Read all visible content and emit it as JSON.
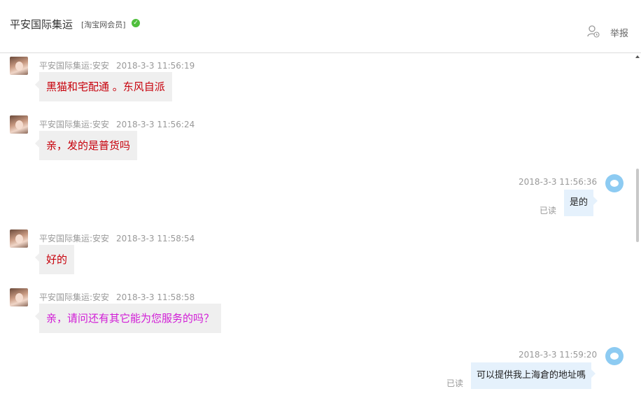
{
  "header": {
    "shop_name": "平安国际集运",
    "shop_tag": "[淘宝网会员]",
    "report_label": "举报"
  },
  "messages": [
    {
      "sender": "平安国际集运:安安",
      "time": "2018-3-3 11:56:19",
      "text": "黑猫和宅配通 。东风自派",
      "side": "left"
    },
    {
      "sender": "平安国际集运:安安",
      "time": "2018-3-3 11:56:24",
      "text": "亲，发的是普货吗",
      "side": "left"
    },
    {
      "time": "2018-3-3 11:56:36",
      "text": "是的",
      "status": "已读",
      "side": "right"
    },
    {
      "sender": "平安国际集运:安安",
      "time": "2018-3-3 11:58:54",
      "text": "好的",
      "side": "left"
    },
    {
      "sender": "平安国际集运:安安",
      "time": "2018-3-3 11:58:58",
      "text": "亲，请问还有其它能为您服务的吗？",
      "side": "left"
    },
    {
      "time": "2018-3-3 11:59:20",
      "text": "可以提供我上海倉的地址嗎",
      "status": "已读",
      "side": "right"
    }
  ]
}
